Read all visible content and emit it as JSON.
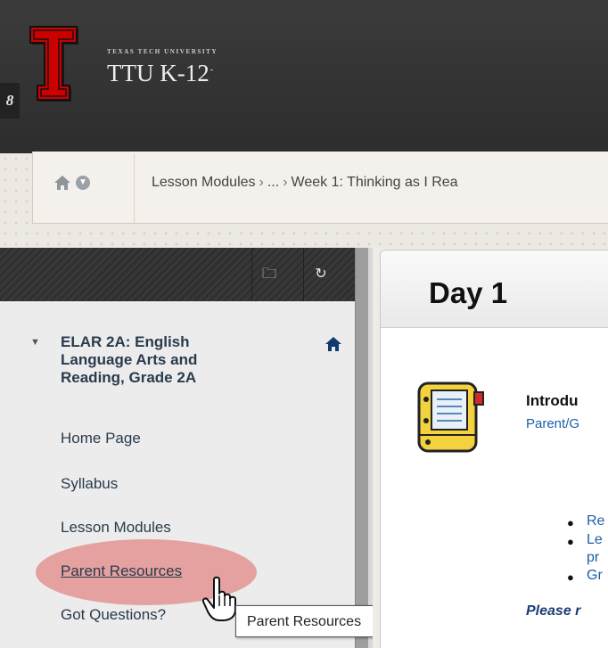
{
  "header": {
    "logo_small_text": "TEXAS TECH UNIVERSITY",
    "logo_name": "TTU K-12",
    "logo_mark": "-",
    "quicklinks_glyph": "8"
  },
  "breadcrumb": {
    "items": [
      "Lesson Modules",
      "...",
      "Week 1: Thinking as I Rea"
    ],
    "separator": ">"
  },
  "sidebar": {
    "course_title": "ELAR 2A: English Language Arts and Reading, Grade 2A",
    "items": [
      {
        "label": "Home Page"
      },
      {
        "label": "Syllabus"
      },
      {
        "label": "Lesson Modules"
      },
      {
        "label": "Parent Resources"
      },
      {
        "label": "Got Questions?"
      }
    ],
    "tooltip": "Parent Resources"
  },
  "content": {
    "page_title": "Day 1",
    "item_title": "Introdu",
    "item_link": "Parent/G",
    "bullets": [
      "Re",
      "Le",
      "pr",
      "Gr"
    ],
    "note": "Please r"
  },
  "colors": {
    "header_bg": "#333333",
    "logo_red": "#cc0000",
    "link_blue": "#1c5fa8",
    "nav_text": "#2a3b4c",
    "highlight": "#dd5454"
  }
}
